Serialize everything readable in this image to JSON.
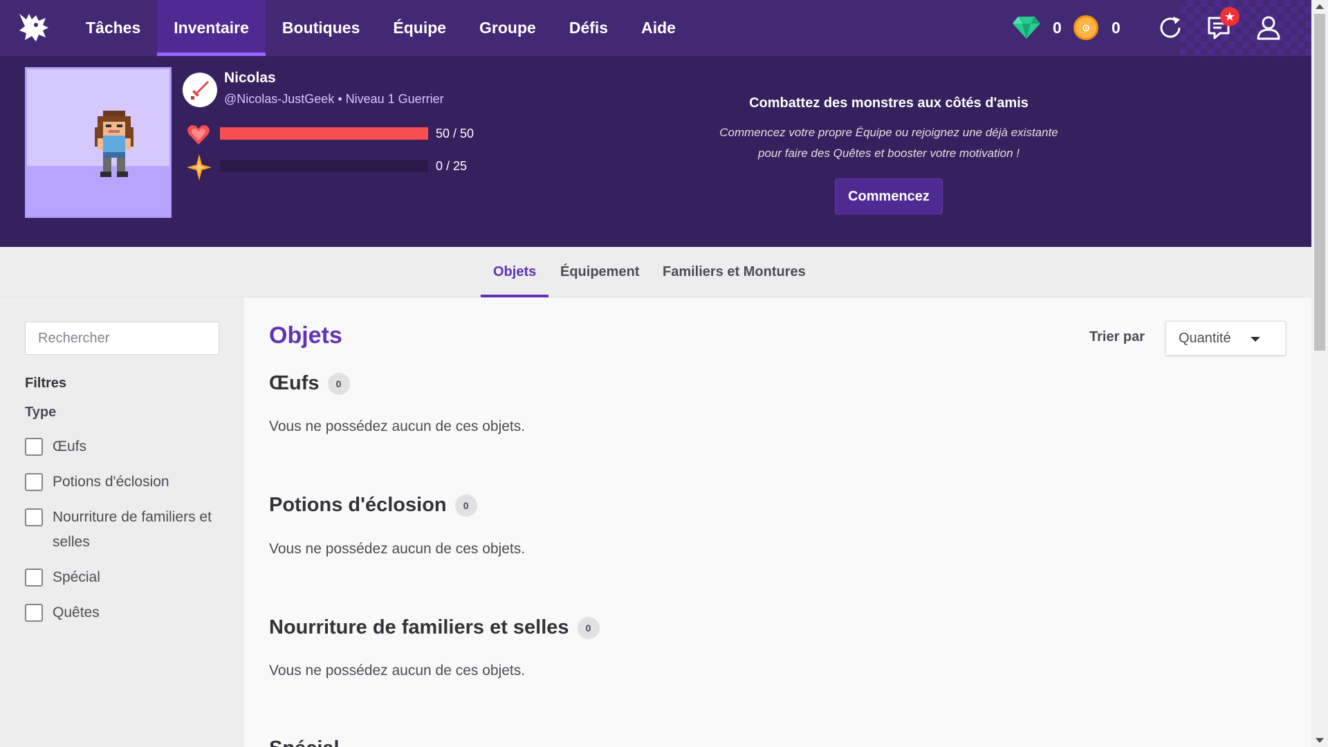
{
  "nav": {
    "items": [
      {
        "label": "Tâches"
      },
      {
        "label": "Inventaire",
        "active": true
      },
      {
        "label": "Boutiques"
      },
      {
        "label": "Équipe"
      },
      {
        "label": "Groupe"
      },
      {
        "label": "Défis"
      },
      {
        "label": "Aide"
      }
    ],
    "gems": "0",
    "gold": "0",
    "gold_symbol": "⊙"
  },
  "user": {
    "name": "Nicolas",
    "line": "@Nicolas-JustGeek • Niveau 1 Guerrier",
    "health": {
      "label": "50 / 50",
      "fraction": 1.0
    },
    "experience": {
      "label": "0 / 25",
      "fraction": 0.0
    }
  },
  "party": {
    "title": "Combattez des monstres aux côtés d'amis",
    "desc_line1": "Commencez votre propre Équipe ou rejoignez une déjà existante",
    "desc_line2": "pour faire des Quêtes et booster votre motivation !",
    "button": "Commencez"
  },
  "tabs": [
    {
      "label": "Objets",
      "active": true
    },
    {
      "label": "Équipement"
    },
    {
      "label": "Familiers et Montures"
    }
  ],
  "sidebar": {
    "search_placeholder": "Rechercher",
    "filters_title": "Filtres",
    "type_title": "Type",
    "types": [
      {
        "label": "Œufs"
      },
      {
        "label": "Potions d'éclosion"
      },
      {
        "label": "Nourriture de familiers et selles"
      },
      {
        "label": "Spécial"
      },
      {
        "label": "Quêtes"
      }
    ]
  },
  "main": {
    "title": "Objets",
    "sort_label": "Trier par",
    "sort_value": "Quantité",
    "sections": [
      {
        "title": "Œufs",
        "count": "0",
        "empty": "Vous ne possédez aucun de ces objets."
      },
      {
        "title": "Potions d'éclosion",
        "count": "0",
        "empty": "Vous ne possédez aucun de ces objets."
      },
      {
        "title": "Nourriture de familiers et selles",
        "count": "0",
        "empty": "Vous ne possédez aucun de ces objets."
      },
      {
        "title": "Spécial"
      }
    ]
  },
  "colors": {
    "nav_bg": "#432874",
    "header_bg": "#36205d",
    "accent": "#6133b4",
    "health": "#f74e52",
    "gem": "#24cc8f",
    "gold": "#ffb445"
  }
}
